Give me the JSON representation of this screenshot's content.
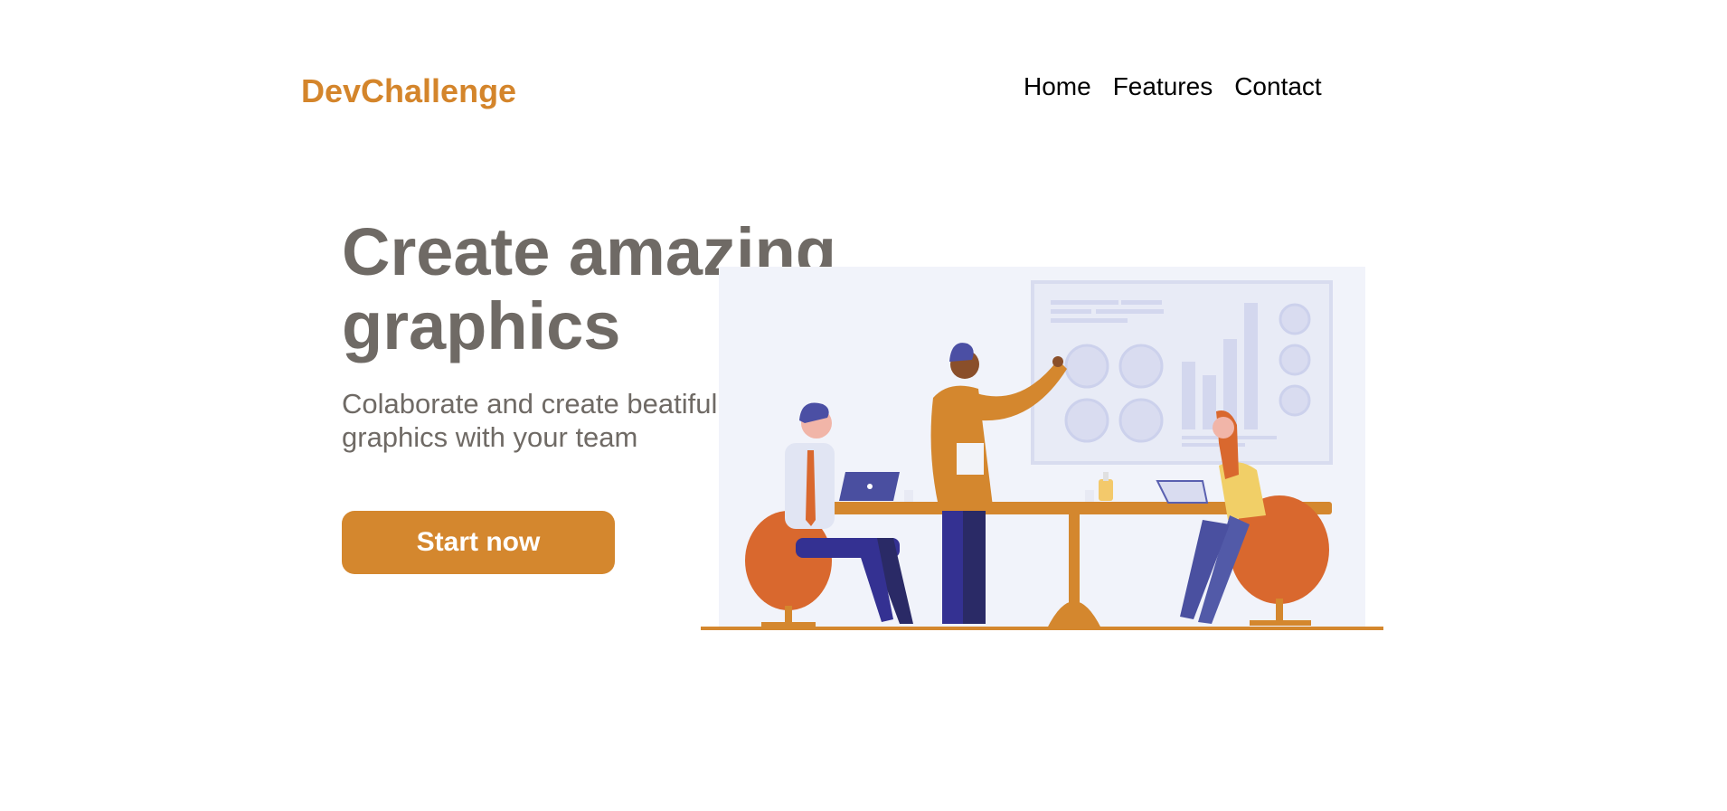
{
  "header": {
    "logo": "DevChallenge",
    "nav": [
      "Home",
      "Features",
      "Contact"
    ]
  },
  "hero": {
    "title_line1": "Create amazing",
    "title_line2": "graphics",
    "subtitle": "Colaborate and create beatiful graphics with your team",
    "cta_label": "Start now"
  },
  "colors": {
    "accent": "#d4852b",
    "text_gray": "#6f6a65",
    "button": "#d4872e",
    "nav_text": "#000000"
  },
  "illustration": {
    "description_icon": "team-meeting-illustration"
  }
}
